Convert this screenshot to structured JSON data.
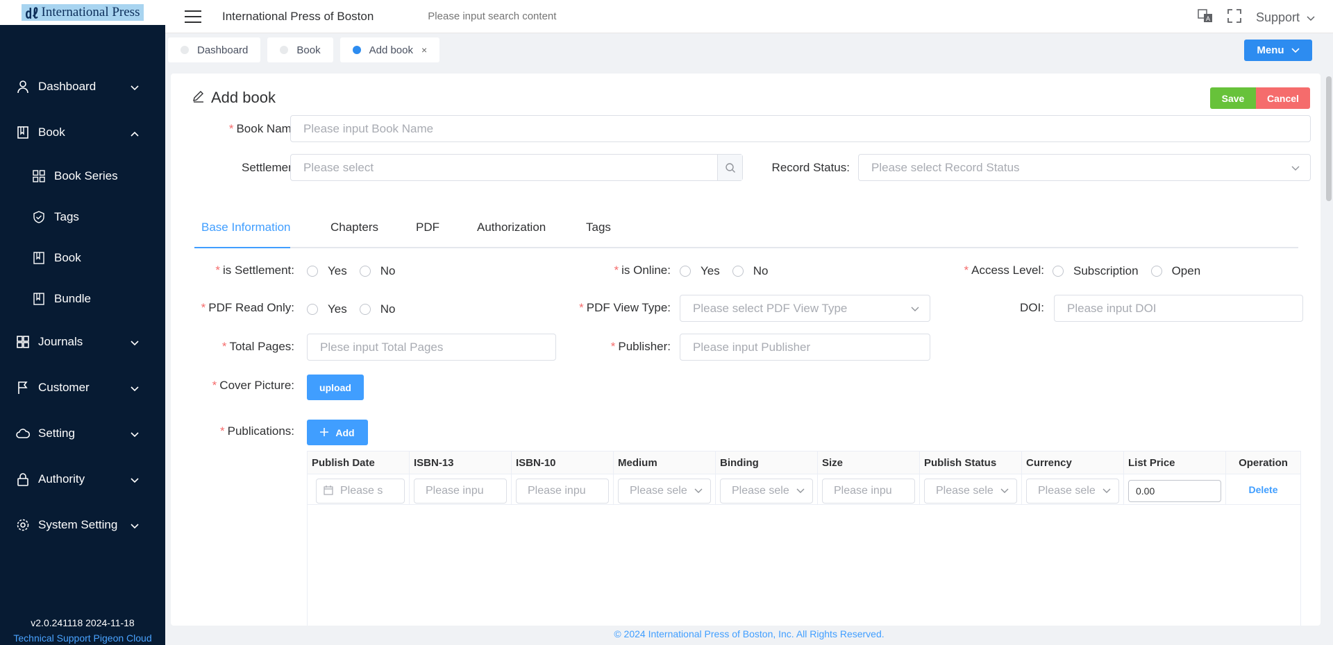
{
  "app": {
    "logo_text": "International Press",
    "brand": "International Press of Boston"
  },
  "search": {
    "placeholder": "Please input search content"
  },
  "header": {
    "support_label": "Support"
  },
  "tabs_bar": {
    "tabs": [
      {
        "label": "Dashboard",
        "active": false
      },
      {
        "label": "Book",
        "active": false
      },
      {
        "label": "Add book",
        "active": true,
        "closable": true
      }
    ],
    "close_glyph": "×",
    "menu_label": "Menu"
  },
  "sidebar": {
    "items": [
      {
        "label": "Dashboard",
        "icon": "user-icon",
        "expanded": false
      },
      {
        "label": "Book",
        "icon": "book-icon",
        "expanded": true,
        "children": [
          {
            "label": "Book Series",
            "icon": "grid-icon"
          },
          {
            "label": "Tags",
            "icon": "shield-check-icon"
          },
          {
            "label": "Book",
            "icon": "book-icon"
          },
          {
            "label": "Bundle",
            "icon": "book-icon"
          }
        ]
      },
      {
        "label": "Journals",
        "icon": "grid-icon",
        "expanded": false
      },
      {
        "label": "Customer",
        "icon": "flag-icon",
        "expanded": false
      },
      {
        "label": "Setting",
        "icon": "cloud-icon",
        "expanded": false
      },
      {
        "label": "Authority",
        "icon": "lock-icon",
        "expanded": false
      },
      {
        "label": "System Setting",
        "icon": "gear-icon",
        "expanded": false
      }
    ],
    "version": "v2.0.241118 2024-11-18",
    "tech_support": "Technical Support Pigeon Cloud"
  },
  "page": {
    "title": "Add book",
    "save_label": "Save",
    "cancel_label": "Cancel"
  },
  "form": {
    "book_name": {
      "label": "Book Name:",
      "placeholder": "Please input Book Name",
      "required": true
    },
    "settlement": {
      "label": "Settlement:",
      "placeholder": "Please select"
    },
    "record_status": {
      "label": "Record Status:",
      "placeholder": "Please select Record Status"
    }
  },
  "section_tabs": [
    {
      "label": "Base Information",
      "active": true
    },
    {
      "label": "Chapters"
    },
    {
      "label": "PDF"
    },
    {
      "label": "Authorization"
    },
    {
      "label": "Tags"
    }
  ],
  "base": {
    "is_settlement": {
      "label": "is Settlement:",
      "options": [
        "Yes",
        "No"
      ]
    },
    "is_online": {
      "label": "is Online:",
      "options": [
        "Yes",
        "No"
      ]
    },
    "access_level": {
      "label": "Access Level:",
      "options": [
        "Subscription",
        "Open"
      ]
    },
    "pdf_read_only": {
      "label": "PDF Read Only:",
      "options": [
        "Yes",
        "No"
      ]
    },
    "pdf_view_type": {
      "label": "PDF View Type:",
      "placeholder": "Please select PDF View Type"
    },
    "doi": {
      "label": "DOI:",
      "placeholder": "Please input DOI"
    },
    "total_pages": {
      "label": "Total Pages:",
      "placeholder": "Plese input Total Pages"
    },
    "publisher": {
      "label": "Publisher:",
      "placeholder": "Please input Publisher"
    },
    "cover_picture": {
      "label": "Cover Picture:",
      "button": "upload"
    },
    "publications": {
      "label": "Publications:",
      "add_button": "Add"
    }
  },
  "publications_table": {
    "columns": [
      "Publish Date",
      "ISBN-13",
      "ISBN-10",
      "Medium",
      "Binding",
      "Size",
      "Publish Status",
      "Currency",
      "List Price",
      "Operation"
    ],
    "row": {
      "publish_date": "Please s",
      "isbn13": "Please inpu",
      "isbn10": "Please inpu",
      "medium": "Please sele",
      "binding": "Please sele",
      "size": "Please inpu",
      "publish_status": "Please sele",
      "currency": "Please sele",
      "list_price": "0.00",
      "operation": "Delete"
    }
  },
  "footer": {
    "copyright": "© 2024 International Press of Boston, Inc. All Rights Reserved."
  },
  "colors": {
    "primary": "#409eff",
    "sidebar_bg": "#071b33",
    "save": "#67c23a",
    "cancel": "#f56c6c",
    "required": "#f56c6c"
  }
}
